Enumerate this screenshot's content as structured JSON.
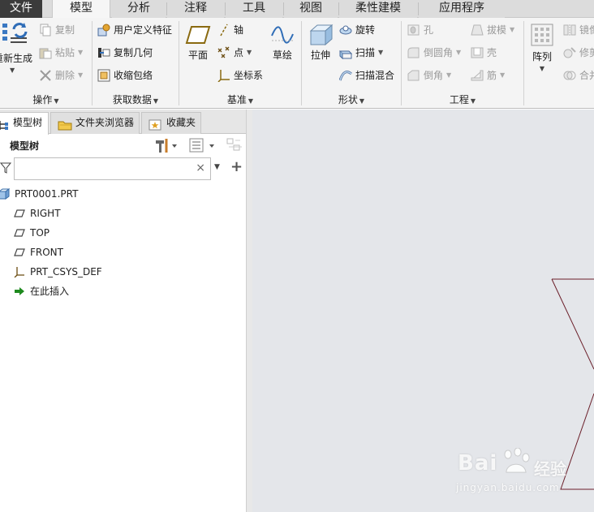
{
  "menu_tabs": [
    {
      "label": "文件"
    },
    {
      "label": "模型"
    },
    {
      "label": "分析"
    },
    {
      "label": "注释"
    },
    {
      "label": "工具"
    },
    {
      "label": "视图"
    },
    {
      "label": "柔性建模"
    },
    {
      "label": "应用程序"
    }
  ],
  "ribbon": {
    "operations": {
      "label": "操作",
      "regenerate": "重新生成",
      "copy": "复制",
      "paste": "粘贴",
      "delete": "删除"
    },
    "get_data": {
      "label": "获取数据",
      "udf": "用户定义特征",
      "copy_geom": "复制几何",
      "shrinkwrap": "收缩包络"
    },
    "datum": {
      "label": "基准",
      "plane": "平面",
      "axis": "轴",
      "point": "点",
      "csys": "坐标系",
      "sketch": "草绘"
    },
    "shapes": {
      "label": "形状",
      "extrude": "拉伸",
      "revolve": "旋转",
      "sweep": "扫描",
      "swept_blend": "扫描混合"
    },
    "engineering": {
      "label": "工程",
      "hole": "孔",
      "draft": "拔模",
      "round": "倒圆角",
      "shell": "壳",
      "chamfer": "倒角",
      "rib": "筋"
    },
    "editing": {
      "pattern": "阵列",
      "mirror": "镜像",
      "trim": "修剪",
      "merge": "合并"
    }
  },
  "panel": {
    "tabs": [
      {
        "label": "模型树"
      },
      {
        "label": "文件夹浏览器"
      },
      {
        "label": "收藏夹"
      }
    ],
    "tree_title": "模型树",
    "search_value": "",
    "search_clear": "×",
    "add_symbol": "+"
  },
  "tree": [
    {
      "label": "PRT0001.PRT",
      "icon": "part-icon"
    },
    {
      "label": "RIGHT",
      "icon": "datum-plane-icon"
    },
    {
      "label": "TOP",
      "icon": "datum-plane-icon"
    },
    {
      "label": "FRONT",
      "icon": "datum-plane-icon"
    },
    {
      "label": "PRT_CSYS_DEF",
      "icon": "csys-icon"
    },
    {
      "label": "在此插入",
      "icon": "insert-here-arrow-icon"
    }
  ],
  "watermark": {
    "brand": "Bai",
    "cn": "经验",
    "url": "jingyan.baidu.com"
  },
  "colors": {
    "file_tab_bg": "#3b3b3b",
    "canvas_bg": "#e4e6ea",
    "sketch_line": "#6b1f2a",
    "insert_arrow": "#1e8a1e"
  }
}
